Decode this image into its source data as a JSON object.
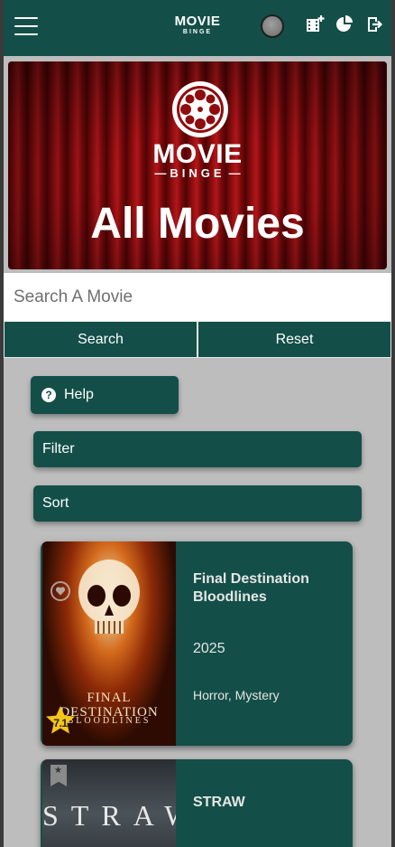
{
  "topbar": {
    "logo_line1": "MOVIE",
    "logo_line2": "BINGE",
    "menu_icon": "hamburger-menu-icon",
    "icons": [
      "add-movie-icon",
      "stats-pie-icon",
      "logout-icon"
    ]
  },
  "banner": {
    "brand": "MOVIE",
    "brand_sub": "BINGE",
    "title": "All Movies"
  },
  "search": {
    "placeholder": "Search A Movie",
    "value": "",
    "search_label": "Search",
    "reset_label": "Reset"
  },
  "controls": {
    "help_label": "Help",
    "filter_label": "Filter",
    "sort_label": "Sort"
  },
  "movies": [
    {
      "title": "Final Destination Bloodlines",
      "year": "2025",
      "genres": "Horror, Mystery",
      "rating": "7.1",
      "poster_line1": "FINAL",
      "poster_line2": "DESTINATION",
      "poster_line3": "BLOODLINES"
    },
    {
      "title": "STRAW",
      "poster_text": "STRAW"
    }
  ],
  "colors": {
    "primary": "#134f48",
    "background": "#bdbdbd",
    "rating_star": "#f5c518"
  }
}
